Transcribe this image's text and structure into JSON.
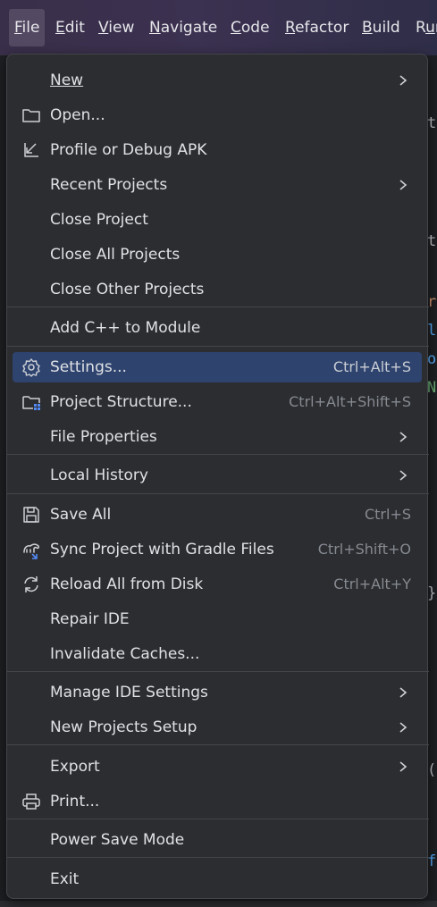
{
  "menubar": {
    "items": [
      {
        "label": "File",
        "active": true
      },
      {
        "label": "Edit"
      },
      {
        "label": "View"
      },
      {
        "label": "Navigate"
      },
      {
        "label": "Code"
      },
      {
        "label": "Refactor"
      },
      {
        "label": "Build"
      },
      {
        "label": "Run"
      }
    ]
  },
  "file_menu": {
    "new": {
      "label": "New",
      "submenu": true
    },
    "open": {
      "label": "Open...",
      "icon": "folder-icon"
    },
    "profile_debug_apk": {
      "label": "Profile or Debug APK",
      "icon": "import-arrow-icon"
    },
    "recent_projects": {
      "label": "Recent Projects",
      "submenu": true
    },
    "close_project": {
      "label": "Close Project"
    },
    "close_all_projects": {
      "label": "Close All Projects"
    },
    "close_other_projects": {
      "label": "Close Other Projects"
    },
    "add_cpp": {
      "label": "Add C++ to Module"
    },
    "settings": {
      "label": "Settings...",
      "shortcut": "Ctrl+Alt+S",
      "icon": "gear-icon",
      "selected": true
    },
    "project_structure": {
      "label": "Project Structure...",
      "shortcut": "Ctrl+Alt+Shift+S",
      "icon": "project-structure-icon"
    },
    "file_properties": {
      "label": "File Properties",
      "submenu": true
    },
    "local_history": {
      "label": "Local History",
      "submenu": true
    },
    "save_all": {
      "label": "Save All",
      "shortcut": "Ctrl+S",
      "icon": "save-icon"
    },
    "sync_gradle": {
      "label": "Sync Project with Gradle Files",
      "shortcut": "Ctrl+Shift+O",
      "icon": "gradle-sync-icon"
    },
    "reload_disk": {
      "label": "Reload All from Disk",
      "shortcut": "Ctrl+Alt+Y",
      "icon": "reload-icon"
    },
    "repair_ide": {
      "label": "Repair IDE"
    },
    "invalidate_caches": {
      "label": "Invalidate Caches..."
    },
    "manage_ide_settings": {
      "label": "Manage IDE Settings",
      "submenu": true
    },
    "new_projects_setup": {
      "label": "New Projects Setup",
      "submenu": true
    },
    "export": {
      "label": "Export",
      "submenu": true
    },
    "print": {
      "label": "Print...",
      "icon": "printer-icon"
    },
    "power_save_mode": {
      "label": "Power Save Mode"
    },
    "exit": {
      "label": "Exit"
    }
  },
  "colors": {
    "menu_bg": "#2b2d30",
    "selection": "#2e436e",
    "text": "#dfe1e5",
    "shortcut_text": "#868a91",
    "separator": "#43454a",
    "accent_blue": "#548af7"
  }
}
